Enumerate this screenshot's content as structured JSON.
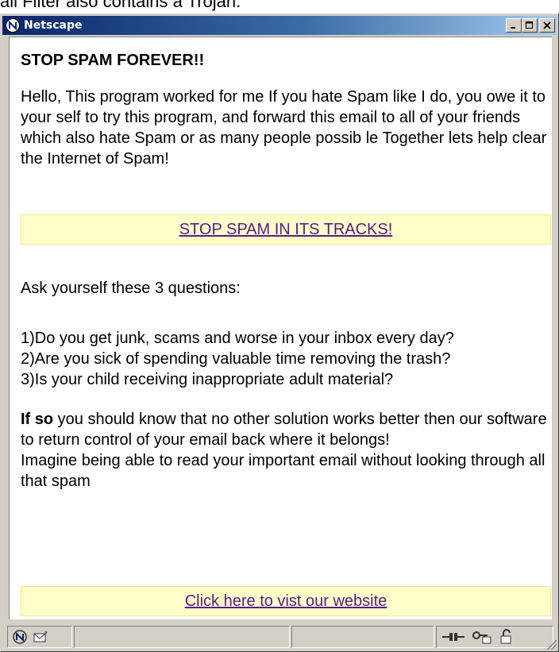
{
  "document_caption": "ail Filter also contains a Trojan.",
  "window": {
    "title": "Netscape"
  },
  "message": {
    "headline": "STOP SPAM FOREVER!!",
    "intro": "Hello, This program worked for me If you hate Spam like I do, you owe it to your self to try this program, and forward this email to all of your friends which also hate Spam or as many people possib le Together lets help clear the Internet of Spam!",
    "link_stop": "STOP SPAM IN ITS TRACKS!",
    "ask": "Ask yourself these 3 questions:",
    "questions": [
      "1)Do you get junk, scams and worse in your inbox every day?",
      "2)Are you sick of spending valuable time removing the trash?",
      "3)Is your child receiving inappropriate adult material?"
    ],
    "ifso_bold": "If so",
    "ifso_rest": " you should know that no other solution works better then our software to return control of your email back where it belongs!",
    "imagine": "Imagine being able to read your important email without looking through all that spam",
    "link_website": "Click here to vist our website"
  },
  "status_icons": [
    "netscape-icon",
    "mail-icon",
    "connection-icon",
    "security-key-icon",
    "lock-icon"
  ],
  "colors": {
    "title_start": "#0a246a",
    "title_end": "#a6caf0",
    "banner_bg": "#ffffc8",
    "link": "#551a8b"
  }
}
